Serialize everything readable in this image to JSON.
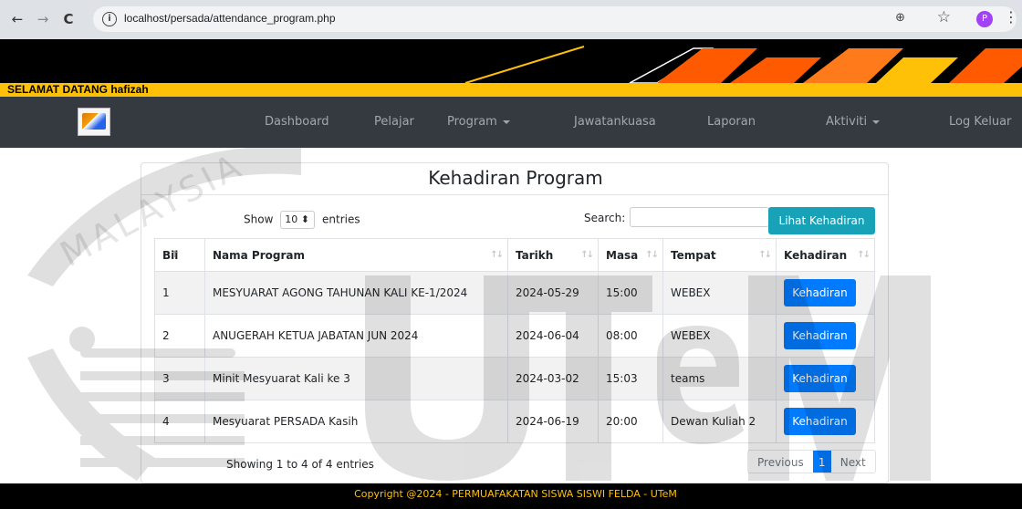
{
  "browser": {
    "url": "localhost/persada/attendance_program.php",
    "back_glyph": "←",
    "forward_glyph": "→",
    "reload_glyph": "C",
    "profile_initial": "P"
  },
  "header": {
    "welcome": "SELAMAT DATANG hafizah"
  },
  "nav": {
    "items": [
      {
        "label": "Dashboard",
        "dropdown": false
      },
      {
        "label": "Pelajar",
        "dropdown": false
      },
      {
        "label": "Program",
        "dropdown": true
      },
      {
        "label": "Jawatankuasa",
        "dropdown": false
      },
      {
        "label": "Laporan",
        "dropdown": false
      },
      {
        "label": "Aktiviti",
        "dropdown": true
      },
      {
        "label": "Log Keluar",
        "dropdown": false
      }
    ]
  },
  "card": {
    "title": "Kehadiran Program",
    "show_label": "Show",
    "show_value": "10",
    "entries_label": "entries",
    "search_label": "Search:",
    "search_value": "",
    "lihat_button": "Lihat Kehadiran"
  },
  "table": {
    "columns": [
      "Bil",
      "Nama Program",
      "Tarikh",
      "Masa",
      "Tempat",
      "Kehadiran"
    ],
    "rows": [
      {
        "bil": "1",
        "nama": "MESYUARAT AGONG TAHUNAN KALI KE-1/2024",
        "tarikh": "2024-05-29",
        "masa": "15:00",
        "tempat": "WEBEX",
        "action": "Kehadiran"
      },
      {
        "bil": "2",
        "nama": "ANUGERAH KETUA JABATAN JUN 2024",
        "tarikh": "2024-06-04",
        "masa": "08:00",
        "tempat": "WEBEX",
        "action": "Kehadiran"
      },
      {
        "bil": "3",
        "nama": "Minit Mesyuarat Kali ke 3",
        "tarikh": "2024-03-02",
        "masa": "15:03",
        "tempat": "teams",
        "action": "Kehadiran"
      },
      {
        "bil": "4",
        "nama": "Mesyuarat PERSADA Kasih",
        "tarikh": "2024-06-19",
        "masa": "20:00",
        "tempat": "Dewan Kuliah 2",
        "action": "Kehadiran"
      }
    ]
  },
  "pagination": {
    "info": "Showing 1 to 4 of 4 entries",
    "previous": "Previous",
    "current": "1",
    "next": "Next"
  },
  "footer": {
    "text": "Copyright @2024 - PERMUAFAKATAN SISWA SISWI FELDA - UTeM"
  },
  "watermark": {
    "text_top": "MALAYSIA",
    "text_main": "UTeM"
  },
  "colors": {
    "accent_yellow": "#ffc107",
    "navbar": "#343a40",
    "primary": "#007bff",
    "info": "#17a2b8"
  }
}
